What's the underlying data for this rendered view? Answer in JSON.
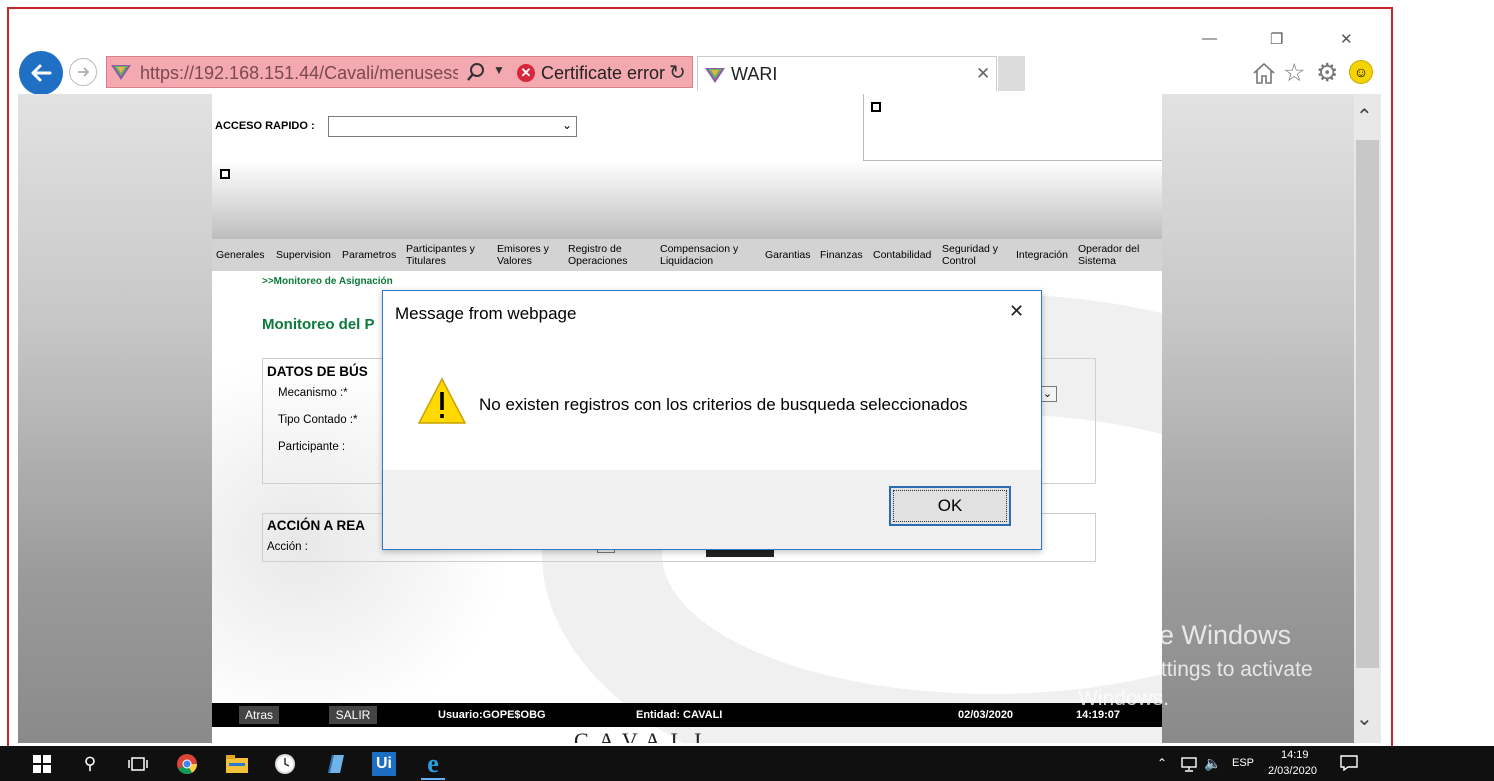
{
  "browser": {
    "url_host": "https://192.168.151.44",
    "url_path": "/Cavali/menusess",
    "cert_error": "Certificate error",
    "tab_title": "WARI"
  },
  "page": {
    "quick_access_label": "ACCESO RAPIDO :",
    "menu": [
      "Generales",
      "Supervision",
      "Parametros",
      "Participantes y Titulares",
      "Emisores y Valores",
      "Registro de Operaciones",
      "Compensacion y Liquidacion",
      "Garantias",
      "Finanzas",
      "Contabilidad",
      "Seguridad y Control",
      "Integración",
      "Operador del Sistema"
    ],
    "breadcrumb": ">>Monitoreo de Asignación",
    "title": "Monitoreo del P",
    "search_section": "DATOS DE BÚS",
    "mecanismo_label": "Mecanismo :*",
    "tipo_contado_label": "Tipo Contado :*",
    "participante_label": "Participante :",
    "action_section": "ACCIÓN A REA",
    "accion_label": "Acción :",
    "footer": {
      "back": "Atras",
      "exit": "SALIR",
      "user": "Usuario:GOPE$OBG",
      "entity": "Entidad: CAVALI",
      "date": "02/03/2020",
      "time": "14:19:07",
      "brand": "CAVALI"
    }
  },
  "dialog": {
    "title": "Message from webpage",
    "message": "No existen registros con los criterios de busqueda seleccionados",
    "ok": "OK"
  },
  "watermark": {
    "line1": "Activate Windows",
    "line2": "Go to Settings to activate",
    "line3": "Windows."
  },
  "taskbar": {
    "lang": "ESP",
    "time": "14:19",
    "date": "2/03/2020"
  },
  "colors": {
    "frame": "#c1272d",
    "address_error": "#f4a9b1",
    "menu_bg": "#d3d3d3",
    "green_text": "#0b7a3a",
    "dialog_border": "#2d7bc4",
    "ie_blue": "#1f6fc5"
  }
}
